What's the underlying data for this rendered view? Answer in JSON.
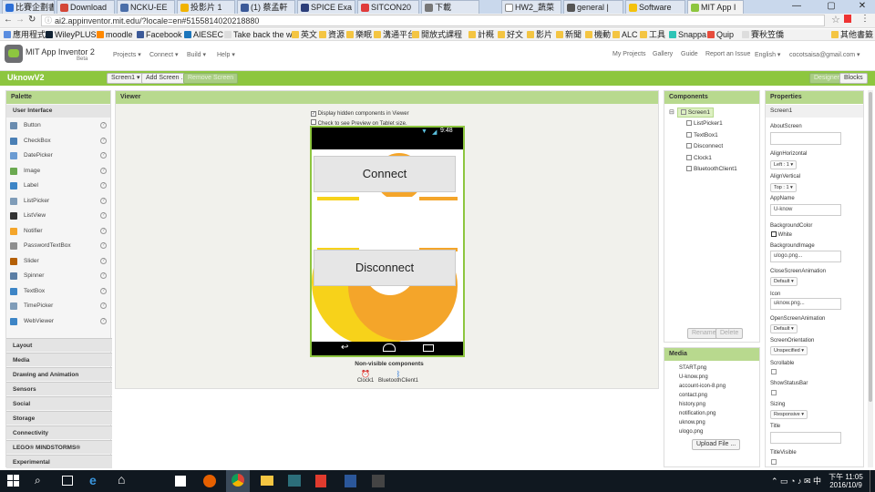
{
  "browser": {
    "tabs": [
      {
        "label": "比賽企劃書"
      },
      {
        "label": "Download"
      },
      {
        "label": "NCKU-EE"
      },
      {
        "label": "投影片 1"
      },
      {
        "label": "(1) 蔡孟軒"
      },
      {
        "label": "SPICE Exa"
      },
      {
        "label": "SITCON20"
      },
      {
        "label": "下載"
      },
      {
        "label": "HW2_蔬菜"
      },
      {
        "label": "general |"
      },
      {
        "label": "Software"
      },
      {
        "label": "MIT App I"
      }
    ],
    "url": "ai2.appinventor.mit.edu/?locale=en#5155814020218880",
    "bookmarks": [
      "應用程式",
      "WileyPLUS",
      "moodle",
      "Facebook",
      "AIESEC",
      "Take back the w",
      "英文",
      "資源",
      "樂眠",
      "溝通平台",
      "開放式課程",
      "計概",
      "好文",
      "影片",
      "新聞",
      "機動",
      "ALC",
      "工具",
      "Snappa",
      "Quip",
      "賽秋笠僑"
    ],
    "other_bookmarks": "其他書籤"
  },
  "appbar": {
    "title": "MIT App Inventor 2",
    "subtitle": "Beta",
    "menus": [
      "Projects ▾",
      "Connect ▾",
      "Build ▾",
      "Help ▾"
    ],
    "right_links": [
      "My Projects",
      "Gallery",
      "Guide",
      "Report an Issue",
      "English ▾",
      "cocotsaisa@gmail.com ▾"
    ]
  },
  "project": {
    "name": "UknowV2",
    "screen_dropdown": "Screen1 ▾",
    "add_screen": "Add Screen ...",
    "remove_screen": "Remove Screen",
    "designer": "Designer",
    "blocks": "Blocks"
  },
  "palette": {
    "header": "Palette",
    "section": "User Interface",
    "items": [
      "Button",
      "CheckBox",
      "DatePicker",
      "Image",
      "Label",
      "ListPicker",
      "ListView",
      "Notifier",
      "PasswordTextBox",
      "Slider",
      "Spinner",
      "TextBox",
      "TimePicker",
      "WebViewer"
    ],
    "categories": [
      "Layout",
      "Media",
      "Drawing and Animation",
      "Sensors",
      "Social",
      "Storage",
      "Connectivity",
      "LEGO® MINDSTORMS®",
      "Experimental"
    ]
  },
  "viewer": {
    "header": "Viewer",
    "display_hidden": "Display hidden components in Viewer",
    "tablet_preview": "Check to see Preview on Tablet size.",
    "status_time": "9:48",
    "connect_button": "Connect",
    "disconnect_button": "Disconnect",
    "nonvisible_title": "Non-visible components",
    "nonvisible": [
      "Clock1",
      "BluetoothClient1"
    ]
  },
  "components": {
    "header": "Components",
    "root": "Screen1",
    "children": [
      "ListPicker1",
      "TextBox1",
      "Disconnect",
      "Clock1",
      "BluetoothClient1"
    ],
    "rename": "Rename",
    "delete": "Delete"
  },
  "media": {
    "header": "Media",
    "files": [
      "START.png",
      "U-know.png",
      "account-icon-8.png",
      "contact.png",
      "history.png",
      "notification.png",
      "uknow.png",
      "ulogo.png"
    ],
    "upload": "Upload File ..."
  },
  "properties": {
    "header": "Properties",
    "component": "Screen1",
    "about_screen_label": "AboutScreen",
    "align_h_label": "AlignHorizontal",
    "align_h_value": "Left : 1 ▾",
    "align_v_label": "AlignVertical",
    "align_v_value": "Top : 1 ▾",
    "app_name_label": "AppName",
    "app_name_value": "U-know",
    "bg_color_label": "BackgroundColor",
    "bg_color_value": "White",
    "bg_image_label": "BackgroundImage",
    "bg_image_value": "ulogo.png...",
    "close_anim_label": "CloseScreenAnimation",
    "close_anim_value": "Default ▾",
    "icon_label": "Icon",
    "icon_value": "uknow.png...",
    "open_anim_label": "OpenScreenAnimation",
    "open_anim_value": "Default ▾",
    "orientation_label": "ScreenOrientation",
    "orientation_value": "Unspecified ▾",
    "scrollable_label": "Scrollable",
    "statusbar_label": "ShowStatusBar",
    "sizing_label": "Sizing",
    "sizing_value": "Responsive ▾",
    "title_label": "Title",
    "titlevisible_label": "TitleVisible"
  },
  "taskbar": {
    "time": "下午 11:05",
    "date": "2016/10/9"
  },
  "colors": {
    "brand_green": "#8dc63f",
    "panel_header": "#b8d98e",
    "accent_orange": "#f4a52a",
    "accent_yellow": "#f7d21a"
  }
}
